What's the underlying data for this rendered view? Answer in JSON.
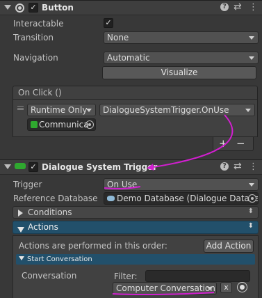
{
  "button_component": {
    "title": "Button",
    "interactable_label": "Interactable",
    "interactable_checked": "✓",
    "transition_label": "Transition",
    "transition_value": "None",
    "navigation_label": "Navigation",
    "navigation_value": "Automatic",
    "visualize_label": "Visualize",
    "onclick_label": "On Click ()",
    "event": {
      "mode": "Runtime Only",
      "function": "DialogueSystemTrigger.OnUse",
      "target": "Communica"
    },
    "plus_label": "+",
    "minus_label": "−"
  },
  "trigger_component": {
    "title": "Dialogue System Trigger",
    "trigger_label": "Trigger",
    "trigger_value": "On Use",
    "refdb_label": "Reference Database",
    "refdb_value": "Demo Database (Dialogue Databa",
    "conditions_label": "Conditions",
    "actions_label": "Actions",
    "actions_help": "Actions are performed in this order:",
    "add_action_label": "Add Action",
    "start_conversation_label": "Start Conversation",
    "conversation_label": "Conversation",
    "filter_label": "Filter:",
    "filter_value": "",
    "conversation_value": "Computer Conversation",
    "clear_label": "x"
  },
  "colors": {
    "annotation": "#d21fd0",
    "component_green": "#2fa82f",
    "actions_header": "#22506b"
  },
  "icons": [
    "gear-icon",
    "help-icon",
    "presets-icon",
    "menu-icon",
    "checkbox-icon",
    "scene-object-icon",
    "database-icon",
    "target-icon"
  ]
}
